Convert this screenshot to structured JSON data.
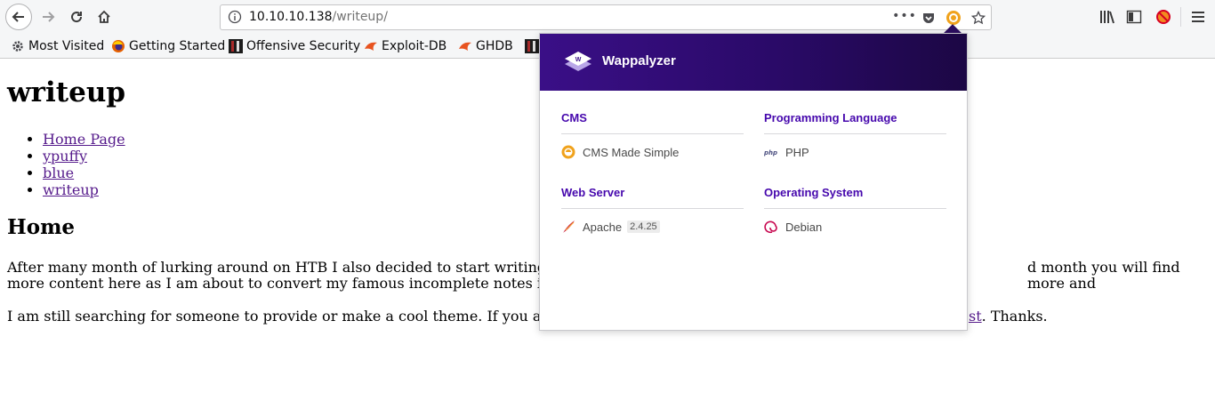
{
  "browser": {
    "url_host": "10.10.10.138",
    "url_path": "/writeup/",
    "url_more": "•••"
  },
  "bookmarks": [
    {
      "label": "Most Visited",
      "icon": "gear-icon"
    },
    {
      "label": "Getting Started",
      "icon": "firefox-icon"
    },
    {
      "label": "Offensive Security",
      "icon": "offsec-icon"
    },
    {
      "label": "Exploit-DB",
      "icon": "exploitdb-icon"
    },
    {
      "label": "GHDB",
      "icon": "ghdb-icon"
    }
  ],
  "page": {
    "title": "writeup",
    "nav": [
      "Home Page",
      "ypuffy",
      "blue",
      "writeup"
    ],
    "heading": "Home",
    "p1_line1_left": "After many month of lurking around on HTB I also decided to start writing",
    "p1_line1_right": "d month you will find more and",
    "p1_line2": "more content here as I am about to convert my famous incomplete notes in",
    "p2_left": "I am still searching for someone to provide or make a cool theme. If you a",
    "p2_link": "st",
    "p2_right": ". Thanks."
  },
  "wappalyzer": {
    "title": "Wappalyzer",
    "categories": [
      {
        "name": "CMS",
        "tech": "CMS Made Simple",
        "version": "",
        "icon": "cms-made-simple-icon"
      },
      {
        "name": "Programming Language",
        "tech": "PHP",
        "version": "",
        "icon": "php-icon"
      },
      {
        "name": "Web Server",
        "tech": "Apache",
        "version": "2.4.25",
        "icon": "apache-feather-icon"
      },
      {
        "name": "Operating System",
        "tech": "Debian",
        "version": "",
        "icon": "debian-swirl-icon"
      }
    ]
  }
}
